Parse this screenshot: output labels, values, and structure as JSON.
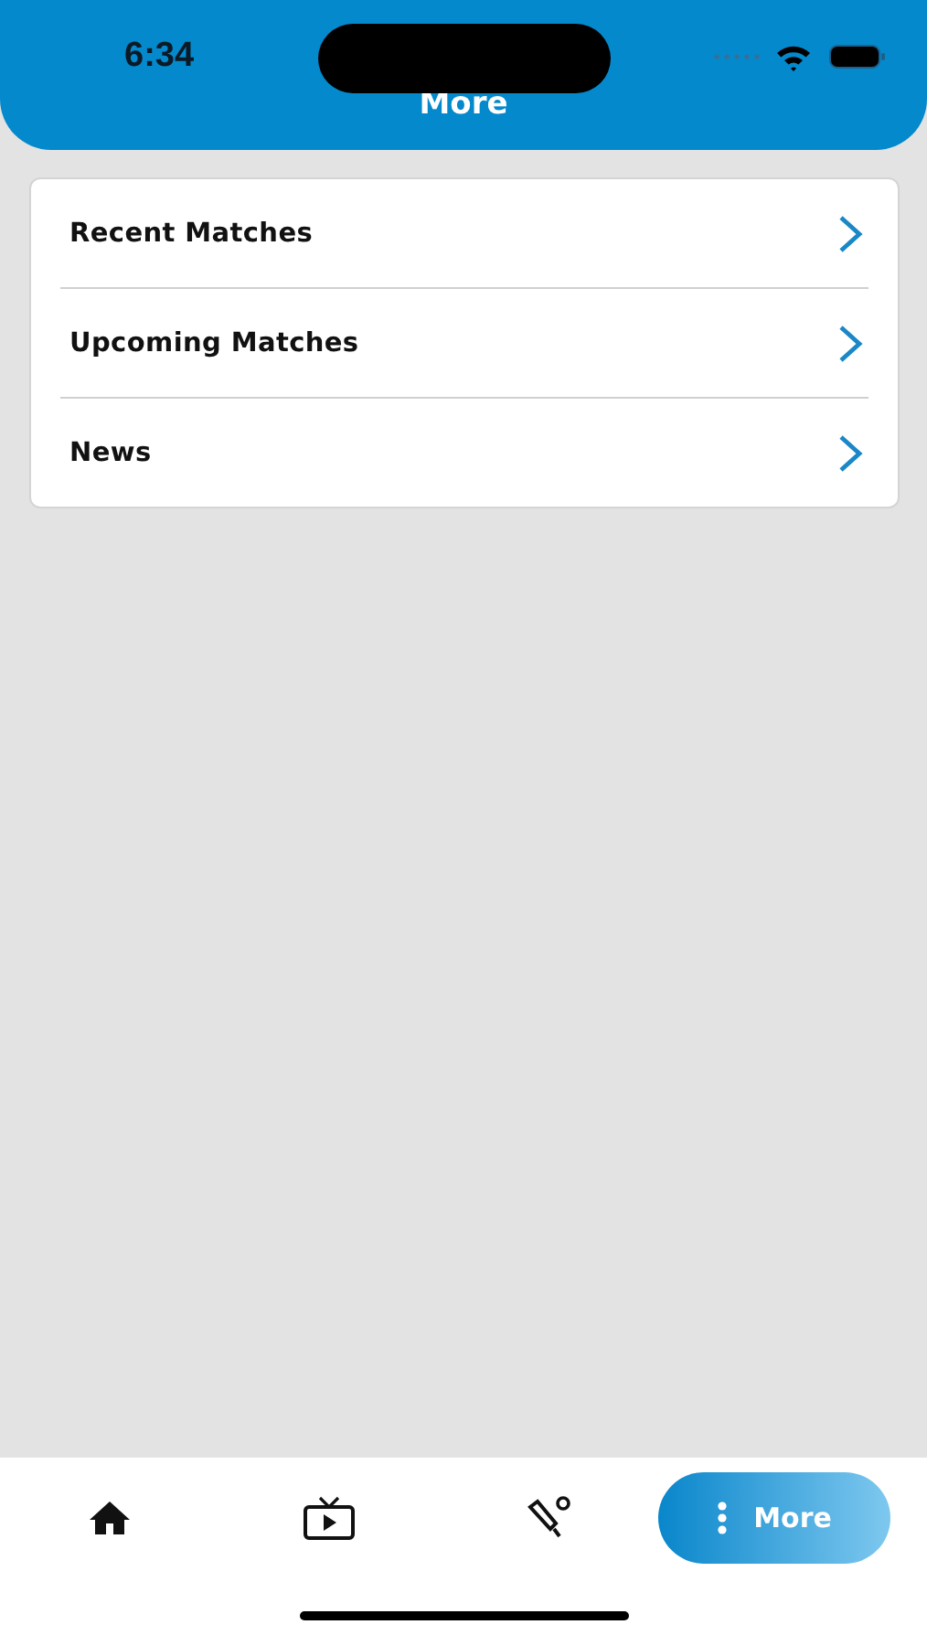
{
  "status_bar": {
    "time": "6:34"
  },
  "header": {
    "title": "More"
  },
  "menu": [
    {
      "label": "Recent Matches"
    },
    {
      "label": "Upcoming Matches"
    },
    {
      "label": "News"
    }
  ],
  "tabs": [
    {
      "kind": "home",
      "selected": false
    },
    {
      "kind": "tv",
      "selected": false
    },
    {
      "kind": "cricket",
      "selected": false
    },
    {
      "kind": "more",
      "label": "More",
      "selected": true
    }
  ]
}
